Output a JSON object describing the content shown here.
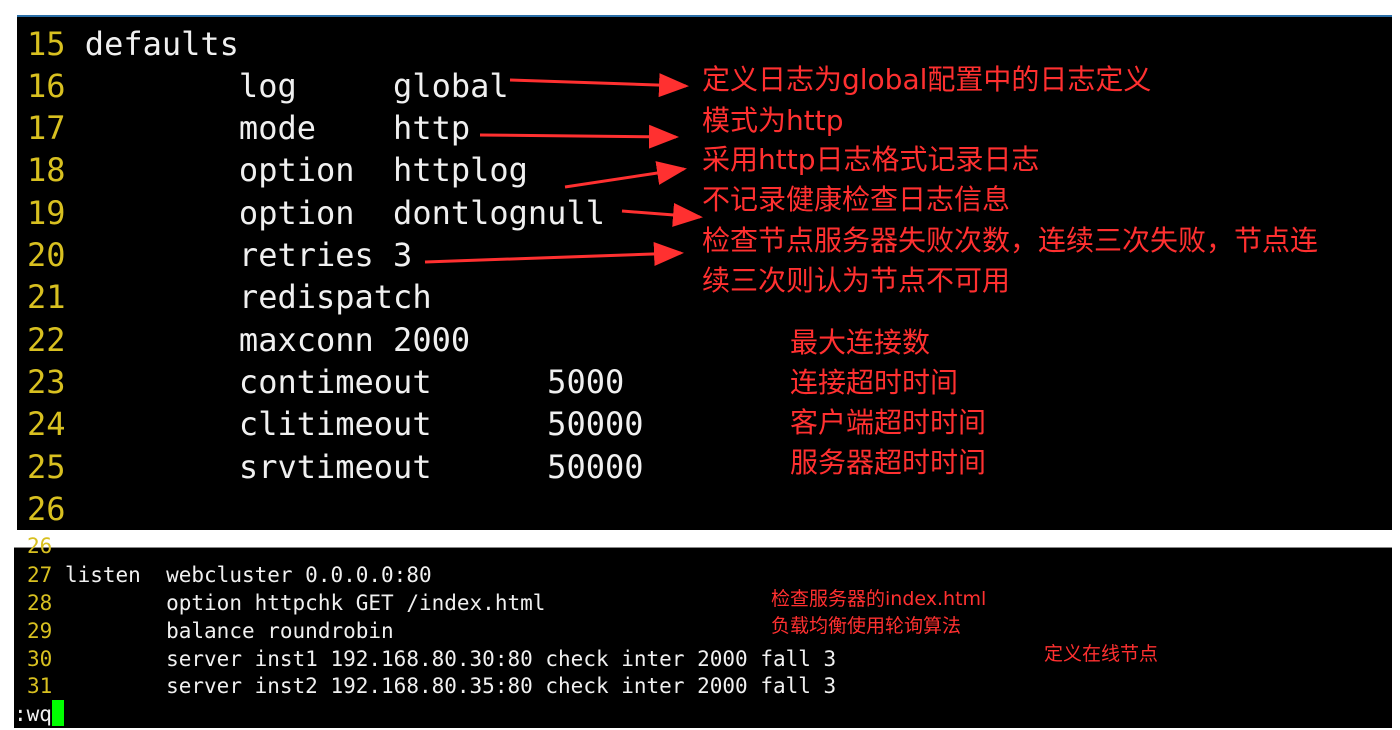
{
  "top_editor": {
    "lines": [
      {
        "num": "15",
        "code": "defaults"
      },
      {
        "num": "16",
        "code": "        log     global"
      },
      {
        "num": "17",
        "code": "        mode    http"
      },
      {
        "num": "18",
        "code": "        option  httplog"
      },
      {
        "num": "19",
        "code": "        option  dontlognull"
      },
      {
        "num": "20",
        "code": "        retries 3"
      },
      {
        "num": "21",
        "code": "        redispatch"
      },
      {
        "num": "22",
        "code": "        maxconn 2000"
      },
      {
        "num": "23",
        "code": "        contimeout      5000"
      },
      {
        "num": "24",
        "code": "        clitimeout      50000"
      },
      {
        "num": "25",
        "code": "        srvtimeout      50000"
      },
      {
        "num": "26",
        "code": ""
      }
    ],
    "annotations": [
      "定义日志为global配置中的日志定义",
      "模式为http",
      "采用http日志格式记录日志",
      "不记录健康检查日志信息",
      "检查节点服务器失败次数，连续三次失败，节点连",
      "续三次则认为节点不可用",
      "最大连接数",
      "连接超时时间",
      "客户端超时时间",
      "服务器超时时间"
    ]
  },
  "bottom_editor": {
    "partial_line_num": "26",
    "lines": [
      {
        "num": "27",
        "code": "listen  webcluster 0.0.0.0:80"
      },
      {
        "num": "28",
        "code": "        option httpchk GET /index.html"
      },
      {
        "num": "29",
        "code": "        balance roundrobin"
      },
      {
        "num": "30",
        "code": "        server inst1 192.168.80.30:80 check inter 2000 fall 3"
      },
      {
        "num": "31",
        "code": "        server inst2 192.168.80.35:80 check inter 2000 fall 3"
      }
    ],
    "annotations": [
      "检查服务器的index.html",
      "负载均衡使用轮询算法",
      "定义在线节点"
    ],
    "command": ":wq"
  },
  "colors": {
    "line_number": "#d8c020",
    "annotation": "#ff3030",
    "cursor": "#00ff00",
    "text": "#f0f0f0",
    "background": "#000000"
  }
}
